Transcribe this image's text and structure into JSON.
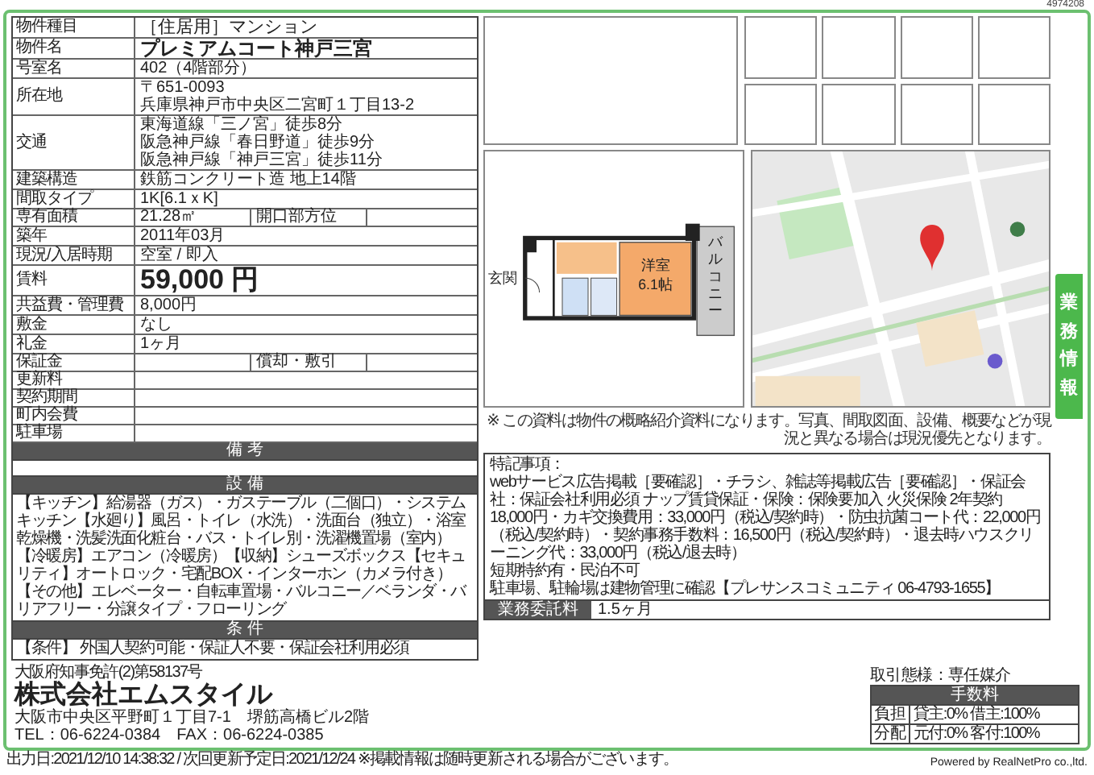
{
  "document_id": "4974208",
  "property": {
    "rows": [
      {
        "kind": "title",
        "label": "物件種目",
        "value": "［住居用］マンション"
      },
      {
        "kind": "name",
        "label": "物件名",
        "value": "プレミアムコート神戸三宮"
      },
      {
        "kind": "text",
        "label": "号室名",
        "value": "402（4階部分）"
      },
      {
        "kind": "address",
        "label": "所在地",
        "postal": "〒651-0093",
        "value": "兵庫県神戸市中央区二宮町１丁目13-2"
      },
      {
        "kind": "lines",
        "label": "交通",
        "lines": [
          "東海道線「三ノ宮」徒歩8分",
          "阪急神戸線「春日野道」徒歩9分",
          "阪急神戸線「神戸三宮」徒歩11分"
        ]
      },
      {
        "kind": "text",
        "label": "建築構造",
        "value": "鉄筋コンクリート造 地上14階"
      },
      {
        "kind": "text",
        "label": "間取タイプ",
        "value": "1K[6.1ｘK]"
      },
      {
        "kind": "split",
        "label": "専有面積",
        "value": "21.28㎡",
        "extra_label": "開口部方位"
      },
      {
        "kind": "text",
        "label": "築年",
        "value": "2011年03月"
      },
      {
        "kind": "text",
        "label": "現況/入居時期",
        "value": "空室 / 即入"
      },
      {
        "kind": "price",
        "label": "賃料",
        "value": "59,000 円"
      },
      {
        "kind": "text",
        "label": "共益費・管理費",
        "value": "8,000円"
      },
      {
        "kind": "text",
        "label": "敷金",
        "value": "なし"
      },
      {
        "kind": "text",
        "label": "礼金",
        "value": "1ヶ月"
      },
      {
        "kind": "split",
        "label": "保証金",
        "extra_label": "償却・敷引"
      },
      {
        "kind": "text",
        "label": "更新料"
      },
      {
        "kind": "text",
        "label": "契約期間"
      },
      {
        "kind": "text",
        "label": "町内会費"
      },
      {
        "kind": "text",
        "label": "駐車場"
      }
    ],
    "sections": [
      {
        "title": "備 考"
      },
      {
        "title": "設 備",
        "text": "【キッチン】給湯器（ガス）・ガステーブル（二個口）・システムキッチン【水廻り】風呂・トイレ（水洗）・洗面台（独立）・浴室乾燥機・洗髪洗面化粧台・バス・トイレ別・洗濯機置場（室内）【冷暖房】エアコン（冷暖房）【収納】シューズボックス【セキュリティ】オートロック・宅配BOX・インターホン（カメラ付き）【その他】エレベーター・自転車置場・バルコニー／ベランダ・バリアフリー・分譲タイプ・フローリング"
      },
      {
        "title": "条 件",
        "text": "【条件】 外国人契約可能・保証人不要・保証会社利用必須"
      }
    ]
  },
  "floor_plan": {
    "room": "洋室",
    "size": "6.1帖",
    "entrance": "玄関",
    "balcony": "バルコニー"
  },
  "disclaimer": "※ この資料は物件の概略紹介資料になります。写真、間取図面、設備、概要などが現況と異なる場合は現況優先となります。",
  "remarks": {
    "title": "特記事項：",
    "lines": [
      "webサービス広告掲載［要確認］・チラシ、雑誌等掲載広告［要確認］・保証会社：保証会社利用必須 ナップ賃貸保証・保険：保険要加入 火災保険 2年契約 18,000円・カギ交換費用：33,000円（税込/契約時）・防虫抗菌コート代：22,000円（税込/契約時）・契約事務手数料：16,500円（税込/契約時）・退去時ハウスクリーニング代：33,000円（税込/退去時）",
      "短期特約有・民泊不可",
      "駐車場、駐輪場は建物管理に確認【プレサンスコミュニティ 06-4793-1655】"
    ]
  },
  "fee": {
    "label": "業務委託料",
    "value": "1.5ヶ月"
  },
  "side_tab": "業務情報",
  "company": {
    "license": "大阪府知事免許(2)第58137号",
    "name": "株式会社エムスタイル",
    "address": "大阪市中央区平野町１丁目7-1　堺筋高橋ビル2階",
    "contact": "TEL：06-6224-0384　FAX：06-6224-0385"
  },
  "transaction": {
    "type": "取引態様：専任媒介",
    "table_title": "手数料",
    "rows": [
      {
        "label": "負担",
        "value": "貸主:0% 借主:100%"
      },
      {
        "label": "分配",
        "value": "元付:0% 客付:100%"
      }
    ]
  },
  "footer": {
    "output": "出力日:2021/12/10 14:38:32 / 次回更新予定日:2021/12/24 ※掲載情報は随時更新される場合がございます。",
    "powered": "Powered by RealNetPro co.,ltd."
  }
}
